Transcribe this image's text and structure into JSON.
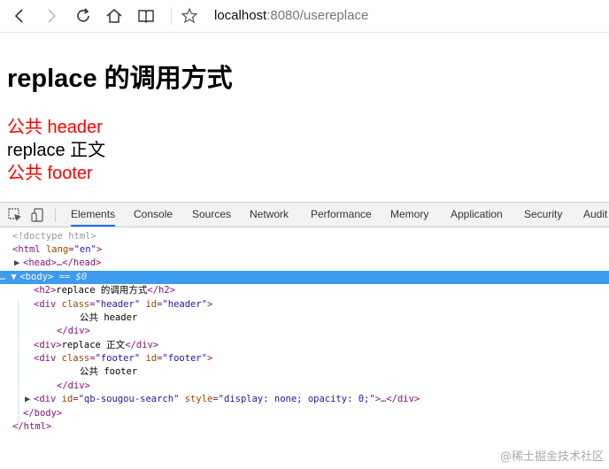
{
  "browser": {
    "url_host": "localhost",
    "url_path": ":8080/usereplace"
  },
  "page": {
    "heading": "replace 的调用方式",
    "header_text": "公共 header",
    "body_text": "replace 正文",
    "footer_text": "公共 footer",
    "colors": {
      "header": "#ff0000",
      "footer": "#ff0000",
      "body": "#000000"
    }
  },
  "devtools": {
    "tabs": [
      "Elements",
      "Console",
      "Sources",
      "Network",
      "Performance",
      "Memory",
      "Application",
      "Security",
      "Audit"
    ],
    "active_tab": "Elements",
    "dom": {
      "doctype": "<!doctype html>",
      "html_open_tag": "html",
      "html_attr": "lang",
      "html_attr_val": "\"en\"",
      "head": "<head>…</head>",
      "body_tag": "<body>",
      "body_marker": "== $0",
      "h2_open": "<h2>",
      "h2_text": "replace 的调用方式",
      "h2_close": "</h2>",
      "div": "div",
      "class_attr": "class",
      "id_attr": "id",
      "header_val": "\"header\"",
      "header_text": "公共 header",
      "div_close": "</div>",
      "div_open": "<div>",
      "body_text": "replace 正文",
      "footer_val": "\"footer\"",
      "footer_text": "公共 footer",
      "search_id": "\"qb-sougou-search\"",
      "style_attr": "style",
      "search_style": "\"display: none; opacity: 0;\"",
      "ellipsis_close": ">…</div>",
      "body_close": "</body>",
      "html_close": "</html>",
      "dots": "…"
    }
  },
  "watermark": "@稀土掘金技术社区"
}
